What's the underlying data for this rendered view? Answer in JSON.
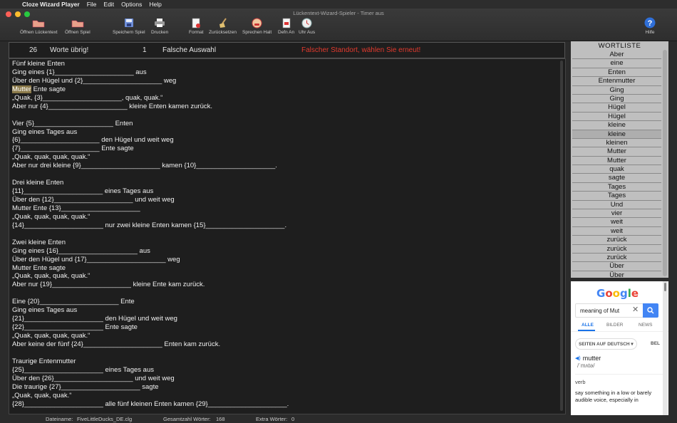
{
  "menubar": {
    "app_name": "Cloze Wizard Player",
    "items": [
      "File",
      "Edit",
      "Options",
      "Help"
    ]
  },
  "window_title": "Lückentext-Wizard-Spieler - Timer aus",
  "toolbar": {
    "open_cloze": "Öffnen Lückentext",
    "open_game": "Öffnen Spiel",
    "save_game": "Speichern Spiel",
    "print": "Drucken",
    "format": "Format",
    "reset": "Zurücksetzen",
    "speak_stop": "Sprechen Halt",
    "defn_on": "Defn An",
    "clock_off": "Uhr Aus",
    "help": "Hilfe"
  },
  "status": {
    "words_left_count": "26",
    "words_left_label": "Worte übrig!",
    "wrong_count": "1",
    "wrong_label": "Falsche Auswahl",
    "message": "Falscher Standort, wählen Sie erneut!",
    "message_color": "#e23a2e"
  },
  "text_lines": [
    "Fünf kleine Enten",
    "Ging eines {1}_____________________ aus",
    "Über den Hügel und {2}_____________________ weg",
    "Mutter Ente sagte",
    "„Quak, {3}_____________________, quak, quak.“",
    "Aber nur {4}_____________________ kleine Enten kamen zurück.",
    "",
    "Vier {5}_____________________ Enten",
    "Ging eines Tages aus",
    "{6}_____________________ den Hügel und weit weg",
    "{7}_____________________ Ente sagte",
    "„Quak, quak, quak, quak.“",
    "Aber nur drei kleine {9}_____________________ kamen {10}_____________________.",
    "",
    "Drei kleine Enten",
    "{11}_____________________ eines Tages aus",
    "Über den {12}_____________________ und weit weg",
    "Mutter Ente {13}_____________________",
    "„Quak, quak, quak, quak.“",
    "{14}_____________________ nur zwei kleine Enten kamen {15}_____________________.",
    "",
    "Zwei kleine Enten",
    "Ging eines {16}_____________________ aus",
    "Über den Hügel und {17}_____________________ weg",
    "Mutter Ente sagte",
    "„Quak, quak, quak, quak.“",
    "Aber nur {19}_____________________ kleine Ente kam zurück.",
    "",
    "Eine {20}_____________________ Ente",
    "Ging eines Tages aus",
    "{21}_____________________ den Hügel und weit weg",
    "{22}_____________________ Ente sagte",
    "„Quak, quak, quak, quak.“",
    "Aber keine der fünf {24}_____________________ Enten kam zurück.",
    "",
    "Traurige Entenmutter",
    "{25}_____________________ eines Tages aus",
    "Über den {26}_____________________ und weit weg",
    "Die traurige {27}_____________________ sagte",
    "„Quak, quak, quak.“",
    "{28}_____________________ alle fünf kleinen Enten kamen {29}_____________________."
  ],
  "highlighted_word": "Mutter",
  "wordlist": {
    "header": "WORTLISTE",
    "selected_index": 9,
    "items": [
      "Aber",
      "eine",
      "Enten",
      "Entenmutter",
      "Ging",
      "Ging",
      "Hügel",
      "Hügel",
      "kleine",
      "kleine",
      "kleinen",
      "Mutter",
      "Mutter",
      "quak",
      "sagte",
      "Tages",
      "Tages",
      "Und",
      "vier",
      "weit",
      "weit",
      "zurück",
      "zurück",
      "zurück",
      "Über",
      "Über"
    ]
  },
  "browser": {
    "logo": "Google",
    "query": "meaning of Mut",
    "tabs": [
      "ALLE",
      "BILDER",
      "NEWS"
    ],
    "chip": "SEITEN AUF DEUTSCH ▾",
    "chip2": "BEL",
    "word": "mutter",
    "phonetic": "/ˈmʌtə/",
    "pos": "verb",
    "definition": "say something in a low or barely audible voice, especially in"
  },
  "footer": {
    "filename_label": "Dateiname:",
    "filename": "FiveLittleDucks_DE.clg",
    "total_label": "Gesamtzahl Wörter:",
    "total": "168",
    "extra_label": "Extra Wörter:",
    "extra": "0"
  }
}
